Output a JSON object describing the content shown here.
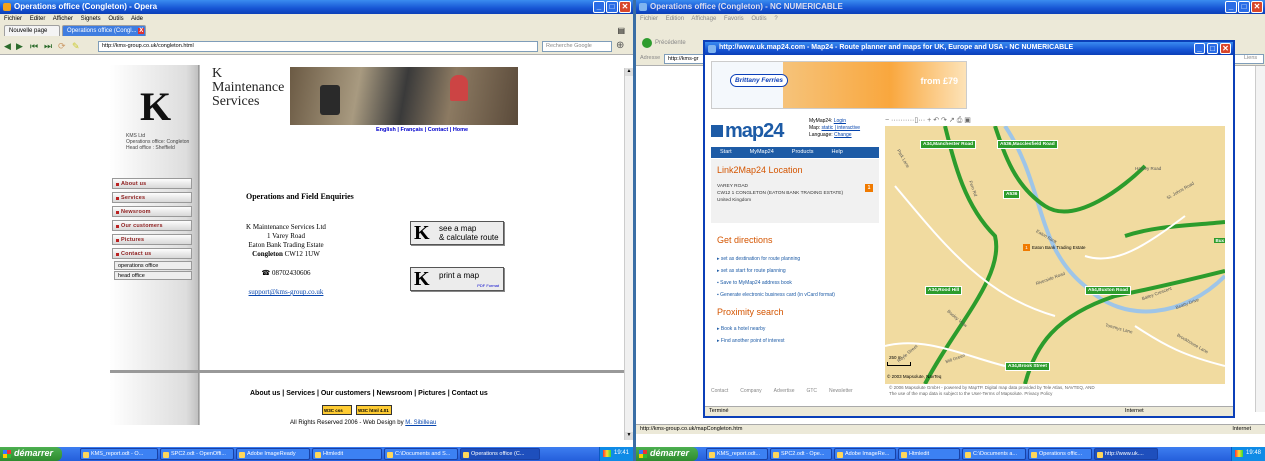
{
  "left_window": {
    "title": "Operations office (Congleton) - Opera",
    "menu": [
      "Fichier",
      "Editer",
      "Afficher",
      "Signets",
      "Outils",
      "Aide"
    ],
    "tabs": [
      "Nouvelle page",
      "Operations office (Congl..."
    ],
    "address": "http://kms-group.co.uk/congleton.html",
    "search_placeholder": "Recherche Google",
    "site": {
      "logo_letter": "K",
      "company_name": "KMS Ltd",
      "ops_line": "Operations office: Congleton",
      "head_line": "Head office : Sheffield",
      "header_title": "K\nMaintenance\nServices",
      "header_links": [
        "English",
        "Français",
        "Contact",
        "Home"
      ],
      "nav": [
        "About us",
        "Services",
        "Newsroom",
        "Our customers",
        "Pictures",
        "Contact us"
      ],
      "subnav": [
        "operations office",
        "head office"
      ],
      "heading": "Operations and Field Enquiries",
      "address_lines": [
        "K Maintenance Services Ltd",
        "1 Varey Road",
        "Eaton Bank Trading Estate"
      ],
      "town": "Congleton",
      "postcode": "CW12 1UW",
      "phone": "☎ 08702430606",
      "email": "support@kms-group.co.uk",
      "map_button": "see a map\n& calculate route",
      "print_button": "print a map",
      "print_sub": "PDF Format",
      "footer_links": [
        "About us",
        "Services",
        "Our customers",
        "Newsroom",
        "Pictures",
        "Contact us"
      ],
      "w3c_css": "W3C css",
      "w3c_html": "W3C html 4.01",
      "copyright": "All Rights Reserved 2006 - Web Design by",
      "designer": "M. Sibilleau"
    },
    "status_url": "",
    "taskbar": {
      "start": "démarrer",
      "items": [
        "KMS_report.odt - O...",
        "SPC2.odt - OpenOffi...",
        "Adobe ImageReady",
        "Htmledit",
        "C:\\Documents and S...",
        "Operations office (C..."
      ],
      "clock": "19:41"
    }
  },
  "right_window": {
    "title": "Operations office (Congleton) - NC NUMERICABLE",
    "menu": [
      "Fichier",
      "Edition",
      "Affichage",
      "Favoris",
      "Outils",
      "?"
    ],
    "back_label": "Précédente",
    "address_label": "Adresse",
    "address": "http://kms-gr",
    "go_label": "OK",
    "links_label": "Liens",
    "status_url": "http://kms-group.co.uk/mapCongleton.htm",
    "status_zone": "Internet",
    "taskbar": {
      "start": "démarrer",
      "items": [
        "KMS_report.odt...",
        "SPC2.odt - Ope...",
        "Adobe ImageRe...",
        "Htmledit",
        "C:\\Documents a...",
        "Operations offic...",
        "http://www.uk...."
      ],
      "clock": "19:48"
    }
  },
  "popup": {
    "title": "http://www.uk.map24.com - Map24 - Route planner and maps for UK, Europe and USA - NC NUMERICABLE",
    "ad_brand": "Brittany Ferries",
    "ad_price": "from £79",
    "logo": "map24",
    "mymap_login_label": "MyMap24:",
    "mymap_login": "Login",
    "map_mode_label": "Map:",
    "map_mode": "static | interactive",
    "language_label": "Language:",
    "language_change": "Change",
    "nav": [
      "Start",
      "MyMap24",
      "Products",
      "Help"
    ],
    "location_title": "Link2Map24 Location",
    "loc_lines": [
      "VAREY ROAD",
      "CW12 1 CONGLETON (EATON BANK TRADING ESTATE)",
      "United Kingdom"
    ],
    "loc_marker": "1",
    "directions_title": "Get directions",
    "directions": [
      "set as destination for route planning",
      "set as start for route planning",
      "Save to MyMap24 address book",
      "Generate electronic business card (in vCard format)"
    ],
    "proximity_title": "Proximity search",
    "proximity": [
      "Book a hotel nearby",
      "Find another point of interest"
    ],
    "footer_nav": [
      "Contact",
      "Company",
      "Advertise",
      "GTC",
      "Newsletter"
    ],
    "copyright_line1": "© 2006 Mapsolute GmbH - powered by MapTP. Digital map data provided by Tele Atlas, NAVTEQ, AND",
    "copyright_line2": "The use of the map data is subject to the User-Terms of Mapsolute. Privacy Policy",
    "status": "Terminé",
    "zone": "Internet",
    "map": {
      "roads": [
        "A34,Manchester Road",
        "A536,Macclesfield Road",
        "A536",
        "A34,Rood Hill",
        "A54,Buxton Road",
        "A34,Brook Street",
        "A54"
      ],
      "streets": [
        "Park Lane",
        "Harvey Road",
        "St. Johns Road",
        "Eaton Bank",
        "Riverside Road",
        "Beatty Drive",
        "Bailey Crescent",
        "Tommys Lane",
        "Royle Street",
        "Mill Green",
        "Brookhouse Lane",
        "Bosley View",
        "Fern Rd"
      ],
      "poi": "Eaton Bank Trading Estate",
      "scale": "250 m",
      "copyright": "© 2003 Mapsolute, NavTeq",
      "bux": "Bux"
    }
  }
}
